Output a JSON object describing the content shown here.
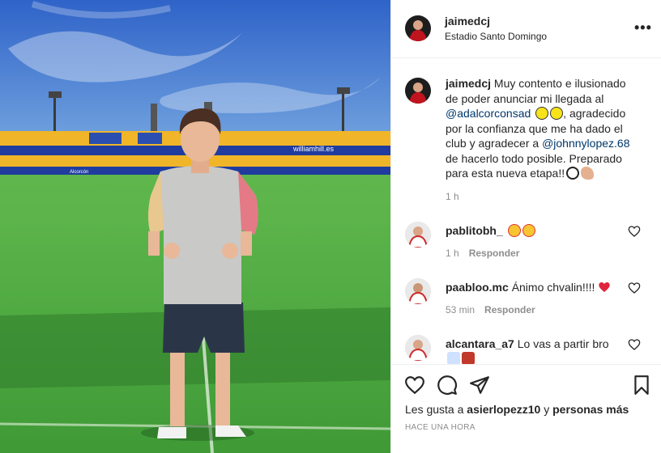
{
  "post": {
    "username": "jaimedcj",
    "location": "Estadio Santo Domingo",
    "more_icon": "more-options-icon",
    "caption": {
      "username": "jaimedcj",
      "part1": " Muy contento e ilusionado de poder anunciar mi llegada al ",
      "mention1": "@adalcorconsad",
      "part2": ", agradecido por la confianza que me ha dado el club y agradecer a ",
      "mention2": "@johnnylopez.68",
      "part3": " de hacerlo todo posible. Preparado para esta nueva etapa!!",
      "time": "1 h"
    },
    "photo": {
      "stadium_banner": "williamhill.es",
      "sponsor_banner": "Alcorcón"
    }
  },
  "comments": [
    {
      "username": "pablitobh_",
      "text": "",
      "time": "1 h",
      "reply": "Responder"
    },
    {
      "username": "paabloo.mc",
      "text": "Ánimo chvalin!!!!",
      "time": "53 min",
      "reply": "Responder"
    },
    {
      "username": "alcantara_a7",
      "text": "Lo vas a partir bro",
      "time": "",
      "reply": ""
    }
  ],
  "actions": {
    "likes_prefix": "Les gusta a ",
    "likes_user": "asierlopezz10",
    "likes_suffix": " y ",
    "likes_others": "personas más",
    "timestamp": "HACE UNA HORA"
  },
  "colors": {
    "mention": "#00376b",
    "secondary_text": "#8e8e8e",
    "heart_red": "#ed4956",
    "pitch_green": "#4da840",
    "sky_blue": "#3f7ad0"
  }
}
